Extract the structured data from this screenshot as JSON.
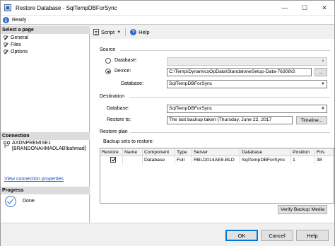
{
  "window": {
    "title": "Restore Database - SqlTempDBForSync",
    "minimize_glyph": "—",
    "maximize_glyph": "☐",
    "close_glyph": "✕"
  },
  "status": {
    "text": "Ready"
  },
  "left_panel": {
    "select_page_header": "Select a page",
    "pages": [
      "General",
      "Files",
      "Options"
    ],
    "connection_header": "Connection",
    "connection_server": "AXDNPREMISE1",
    "connection_user": "[BRANDONAHMADLAB\\bahmad]",
    "view_connection_link": "View connection properties",
    "progress_header": "Progress",
    "progress_status": "Done"
  },
  "toolbar": {
    "script_label": "Script",
    "help_label": "Help"
  },
  "source": {
    "group_label": "Source",
    "database_option_label": "Database:",
    "device_option_label": "Device:",
    "device_value": "C:\\Temp\\DynamicsOpData\\StandaloneSetup-Data-76308\\S",
    "browse_label": "...",
    "database_label": "Database:",
    "database_value": "SqlTempDBForSync",
    "selected_option": "device"
  },
  "destination": {
    "group_label": "Destination",
    "database_label": "Database:",
    "database_value": "SqlTempDBForSync",
    "restore_to_label": "Restore to:",
    "restore_to_value": "The last backup taken (Thursday, June 22, 2017",
    "timeline_label": "Timeline..."
  },
  "restore_plan": {
    "group_label": "Restore plan",
    "backup_sets_label": "Backup sets to restore:",
    "columns": [
      "Restore",
      "Name",
      "Component",
      "Type",
      "Server",
      "Database",
      "Position",
      "Firs"
    ],
    "rows": [
      {
        "restore": true,
        "name": "",
        "component": "Database",
        "type": "Full",
        "server": "RBLD014AE8-BLD",
        "database": "SqlTempDBForSync",
        "position": "1",
        "first": "38"
      }
    ],
    "verify_label": "Verify Backup Media"
  },
  "footer": {
    "ok_label": "OK",
    "cancel_label": "Cancel",
    "help_label": "Help"
  }
}
